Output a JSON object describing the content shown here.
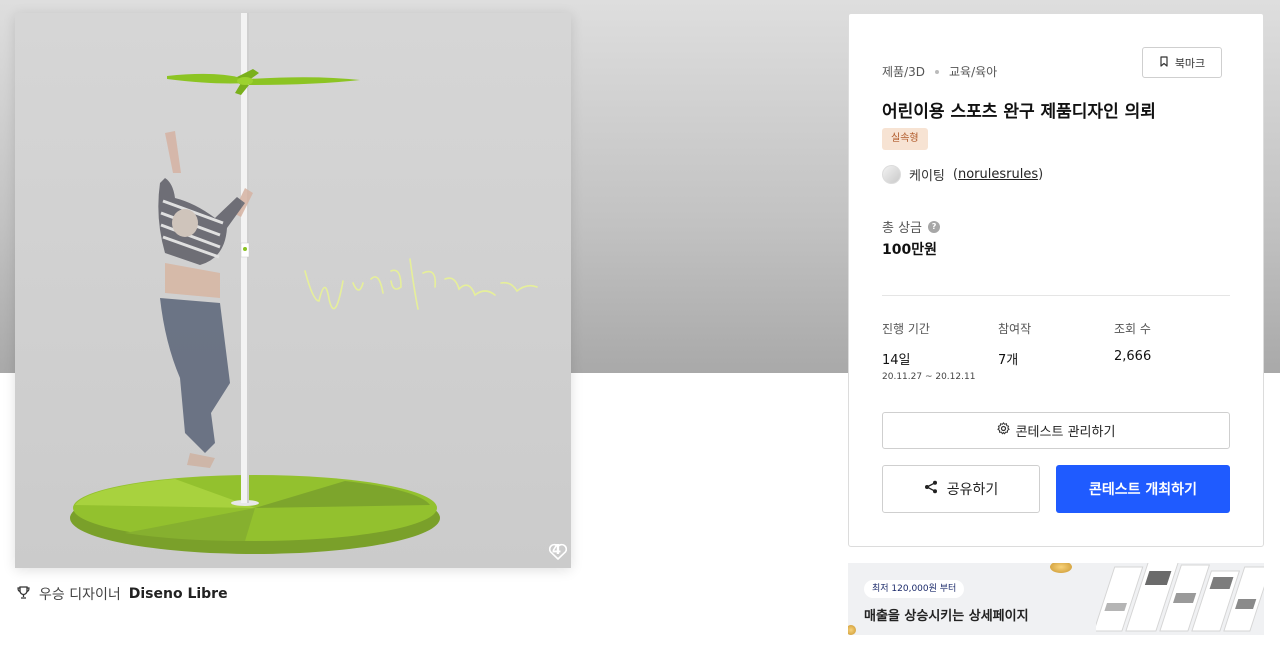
{
  "hero": {
    "like_count": "4",
    "watermark_text": "Windflow"
  },
  "designer": {
    "role": "우승 디자이너",
    "name": "Diseno Libre"
  },
  "contest": {
    "category_1": "제품/3D",
    "category_2": "교육/육아",
    "bookmark_label": "북마크",
    "title": "어린이용 스포츠 완구 제품디자인 의뢰",
    "tag": "실속형",
    "host_name": "케이팅",
    "host_handle": "norulesrules",
    "prize_label": "총 상금",
    "prize_value": "100만원",
    "stats": {
      "period_label": "진행 기간",
      "period_value": "14일",
      "period_range": "20.11.27 ~ 20.12.11",
      "entries_label": "참여작",
      "entries_value": "7개",
      "views_label": "조회 수",
      "views_value": "2,666"
    },
    "manage_label": "콘테스트 관리하기",
    "share_label": "공유하기",
    "host_contest_label": "콘테스트 개최하기"
  },
  "banner": {
    "badge": "최저 120,000원 부터",
    "headline": "매출을 상승시키는 상세페이지"
  },
  "colors": {
    "primary": "#1f5bff",
    "tag_bg": "#f7e3d3",
    "tag_text": "#b05a2a",
    "product_green": "#9ccc2a"
  },
  "icons": [
    "heart-icon",
    "trophy-icon",
    "bookmark-icon",
    "help-icon",
    "gear-icon",
    "share-icon"
  ]
}
